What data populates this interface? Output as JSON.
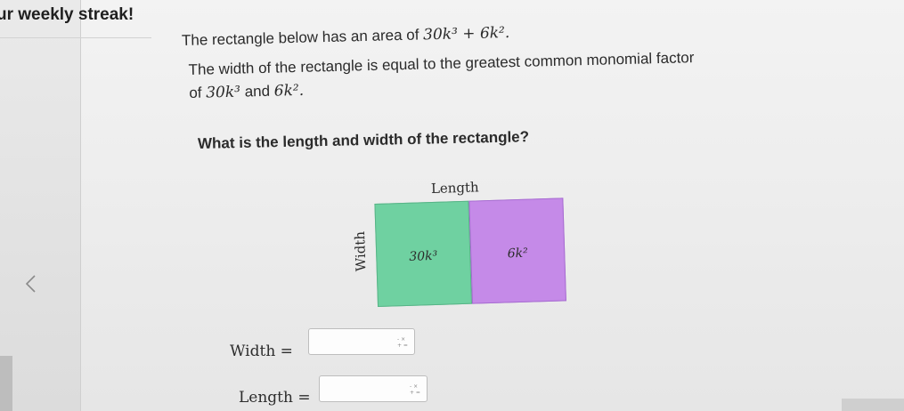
{
  "header": {
    "streak_text": "ur weekly streak!"
  },
  "question": {
    "line1_prefix": "The rectangle below has an area of",
    "line1_expr": "30k³ + 6k².",
    "line2_prefix": "The width of the rectangle is equal to the greatest common monomial factor of",
    "line2_term1": "30k³",
    "line2_and": "and",
    "line2_term2": "6k².",
    "prompt": "What is the length and width of the rectangle?"
  },
  "diagram": {
    "length_label": "Length",
    "width_label": "Width",
    "green_term": "30k³",
    "purple_term": "6k²",
    "colors": {
      "green": "#6fd1a1",
      "purple": "#c58ae8"
    }
  },
  "answers": {
    "width_label": "Width =",
    "length_label": "Length =",
    "width_value": "",
    "length_value": ""
  },
  "icons": {
    "back": "chevron-left-icon",
    "keypad": "math-keypad-icon"
  }
}
